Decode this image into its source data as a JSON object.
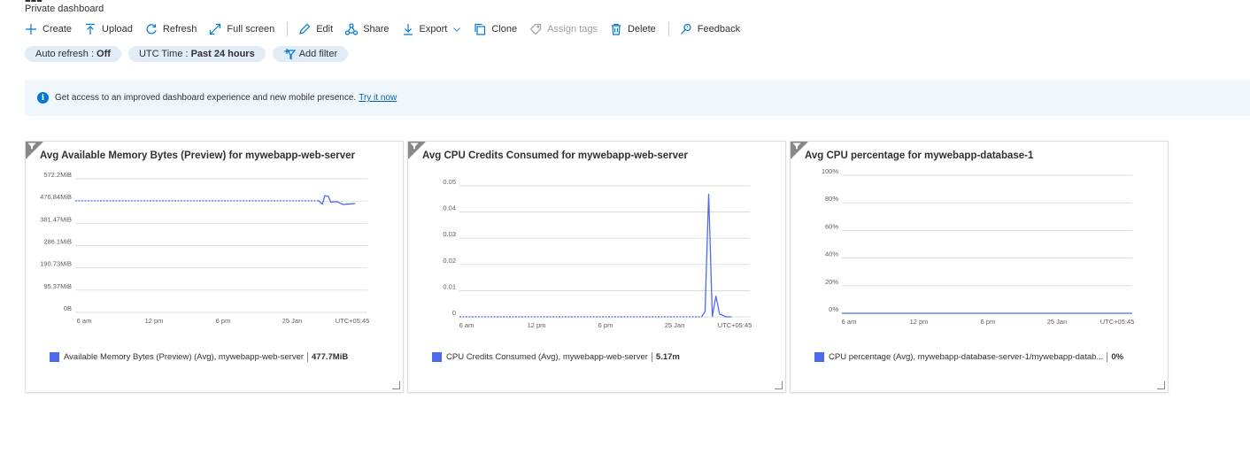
{
  "header": {
    "subtitle": "Private dashboard"
  },
  "toolbar": {
    "create": "Create",
    "upload": "Upload",
    "refresh": "Refresh",
    "fullscreen": "Full screen",
    "edit": "Edit",
    "share": "Share",
    "export": "Export",
    "clone": "Clone",
    "assign_tags": "Assign tags",
    "delete": "Delete",
    "feedback": "Feedback"
  },
  "filters": {
    "auto_refresh_label": "Auto refresh :",
    "auto_refresh_value": "Off",
    "time_label": "UTC Time :",
    "time_value": "Past 24 hours",
    "add_filter": "Add filter"
  },
  "banner": {
    "text": "Get access to an improved dashboard experience and new mobile presence.",
    "link": "Try it now"
  },
  "colors": {
    "accent": "#0078d4",
    "series": "#4f6bed",
    "pill": "#e1ecf7",
    "banner": "#eff6fc"
  },
  "tiles": [
    {
      "title": "Avg Available Memory Bytes (Preview) for mywebapp-web-server",
      "legend_label": "Available Memory Bytes (Preview) (Avg), mywebapp-web-server",
      "legend_value": "477.7MiB"
    },
    {
      "title": "Avg CPU Credits Consumed for mywebapp-web-server",
      "legend_label": "CPU Credits Consumed (Avg), mywebapp-web-server",
      "legend_value": "5.17m"
    },
    {
      "title": "Avg CPU percentage for mywebapp-database-1",
      "legend_label": "CPU percentage (Avg), mywebapp-database-server-1/mywebapp-datab...",
      "legend_value": "0%"
    }
  ],
  "chart_data": [
    {
      "type": "line",
      "title": "Avg Available Memory Bytes (Preview) for mywebapp-web-server",
      "yticks": [
        "572.2MiB",
        "476.84MiB",
        "381.47MiB",
        "286.1MiB",
        "190.73MiB",
        "95.37MiB",
        "0B"
      ],
      "ylim": [
        0,
        572.2
      ],
      "xticks": [
        "6 am",
        "12 pm",
        "6 pm",
        "25 Jan",
        "UTC+05:45"
      ],
      "xlim": [
        0,
        24
      ],
      "series": [
        {
          "name": "Available Memory Bytes (Preview) (Avg), mywebapp-web-server",
          "dashed": {
            "x": [
              0,
              20.0
            ],
            "y": [
              478,
              478
            ]
          },
          "x": [
            20.0,
            20.3,
            20.5,
            20.8,
            21.0,
            21.5,
            22.0,
            23.0
          ],
          "y": [
            478,
            464,
            500,
            496,
            472,
            474,
            462,
            466
          ]
        }
      ],
      "grid": true
    },
    {
      "type": "line",
      "title": "Avg CPU Credits Consumed for mywebapp-web-server",
      "yticks": [
        "0.05",
        "0.04",
        "0.03",
        "0.02",
        "0.01",
        "0"
      ],
      "ylim": [
        0,
        0.05
      ],
      "xticks": [
        "6 am",
        "12 pm",
        "6 pm",
        "25 Jan",
        "UTC+05:45"
      ],
      "xlim": [
        0,
        24
      ],
      "series": [
        {
          "name": "CPU Credits Consumed (Avg), mywebapp-web-server",
          "dashed": {
            "x": [
              0,
              20.0
            ],
            "y": [
              0,
              0
            ]
          },
          "x": [
            20.0,
            20.3,
            20.6,
            20.9,
            21.2,
            21.5,
            21.8,
            22.0,
            22.5
          ],
          "y": [
            0,
            0.002,
            0.047,
            0.0,
            0.008,
            0.001,
            0.0005,
            0,
            0
          ]
        }
      ],
      "grid": true
    },
    {
      "type": "line",
      "title": "Avg CPU percentage for mywebapp-database-1",
      "yticks": [
        "100%",
        "80%",
        "60%",
        "40%",
        "20%",
        "0%"
      ],
      "ylim": [
        0,
        100
      ],
      "xticks": [
        "6 am",
        "12 pm",
        "6 pm",
        "25 Jan",
        "UTC+05:45"
      ],
      "xlim": [
        0,
        24
      ],
      "series": [
        {
          "name": "CPU percentage (Avg), mywebapp-database-server-1/mywebapp-datab...",
          "x": [
            0,
            24
          ],
          "y": [
            0,
            0
          ]
        }
      ],
      "grid": true
    }
  ]
}
